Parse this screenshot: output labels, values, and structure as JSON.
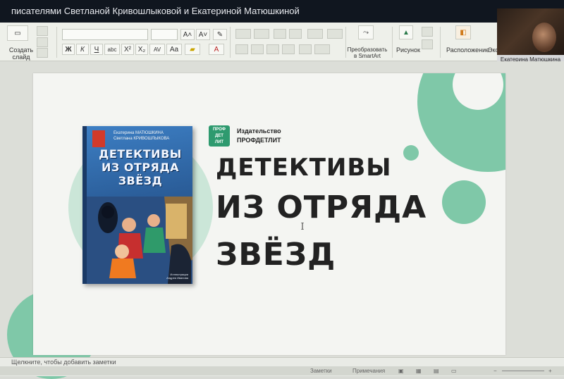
{
  "window": {
    "title": "писателями Светланой Кривошлыковой и Екатериной Матюшкиной"
  },
  "ribbon": {
    "new_slide_label": "Создать слайд",
    "smartart_label": "Преобразовать в SmartArt",
    "picture_label": "Рисунок",
    "arrange_label": "Расположение",
    "cutoff_label": "Экс",
    "font_size_up": "A˄",
    "font_size_down": "A˅",
    "bold": "Ж",
    "italic": "К",
    "underline": "Ч",
    "strike": "abc",
    "superscript": "X²",
    "subscript": "X₂",
    "spacing": "AV",
    "case": "Aa",
    "font_color": "A"
  },
  "webcam": {
    "participant_name": "Екатерина Матюшкина"
  },
  "slide": {
    "book": {
      "authors": "Екатерина МАТЮШКИНА\nСветлана КРИВОШЛЫКОВА",
      "title_line1": "ДЕТЕКТИВЫ",
      "title_line2": "ИЗ ОТРЯДА",
      "title_line3": "ЗВЁЗД",
      "illustrator": "Иллюстрации\nАндрея Иванова"
    },
    "logo": {
      "line1": "ПРОФ",
      "line2": "ДЕТ",
      "line3": "ЛИТ"
    },
    "publisher_text": "Издательство\nПРОФДЕТЛИТ",
    "title_line1": "ДЕТЕКТИВЫ",
    "title_line2": "ИЗ ОТРЯДА",
    "title_line3": "ЗВЁЗД"
  },
  "notes": {
    "placeholder": "Щелкните, чтобы добавить заметки"
  },
  "status": {
    "notes_btn": "Заметки",
    "comments_btn": "Примечания"
  },
  "colors": {
    "accent_green": "#7fc8a8",
    "logo_green": "#2e9a6f",
    "titlebar_bg": "#10161f"
  }
}
